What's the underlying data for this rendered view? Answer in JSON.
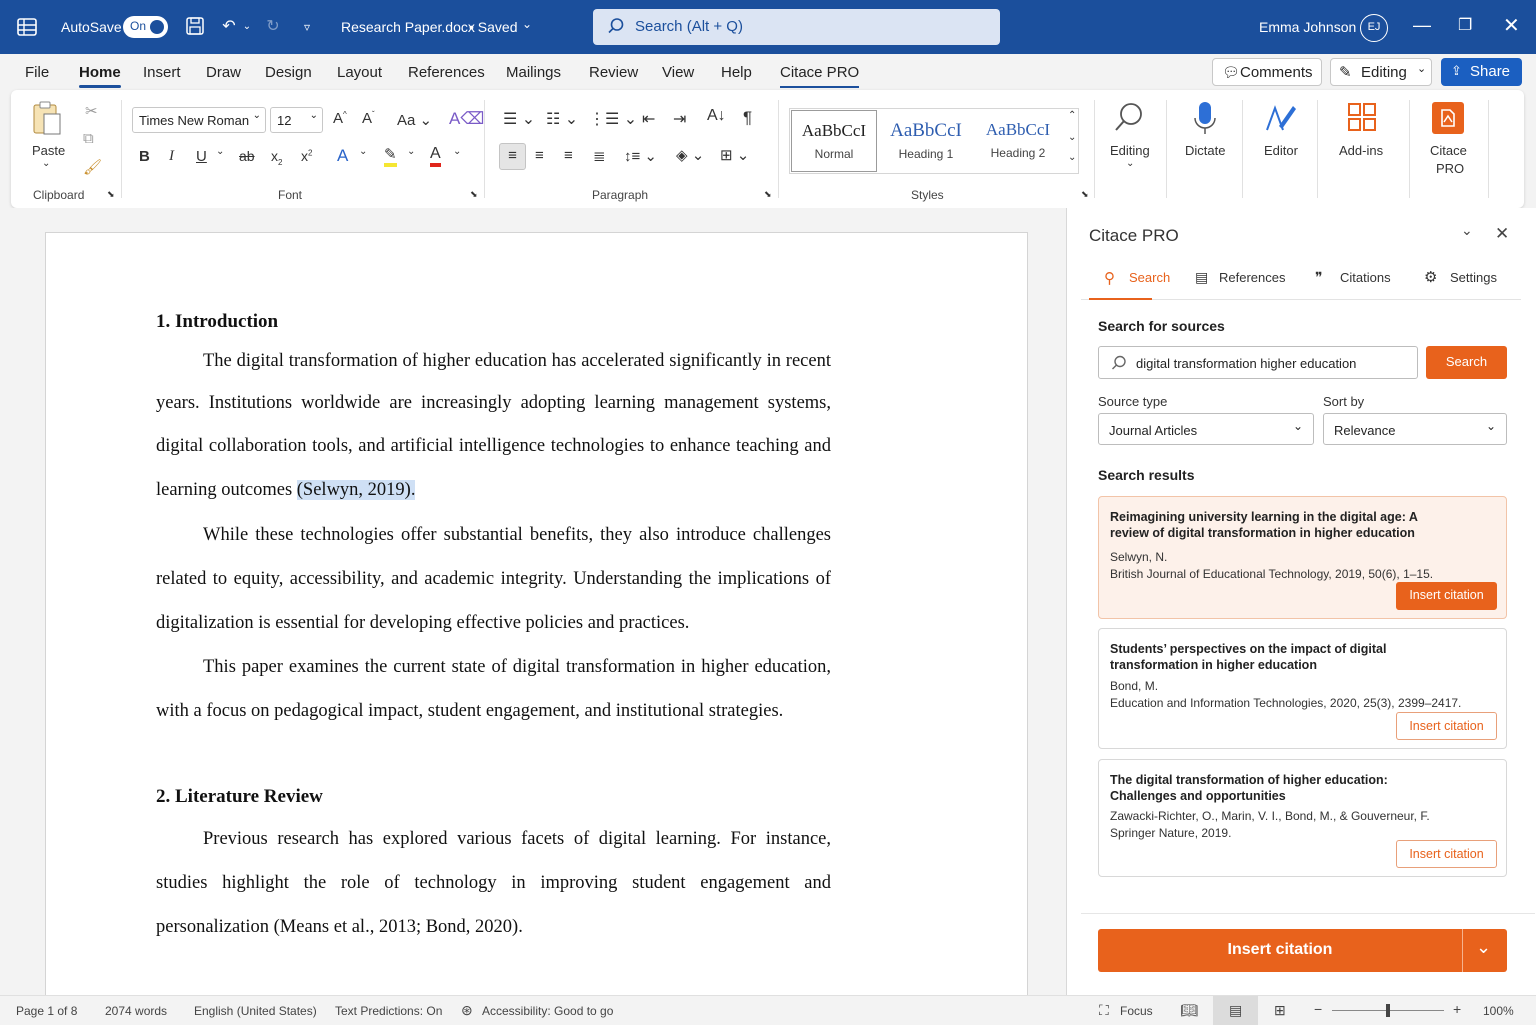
{
  "titlebar": {
    "autosave_label": "AutoSave",
    "autosave_state": "On",
    "doc_name": "Research Paper.docx",
    "doc_state": "• Saved",
    "search_placeholder": "Search (Alt + Q)",
    "user_name": "Emma Johnson",
    "user_initials": "EJ"
  },
  "menu": {
    "tabs": [
      "File",
      "Home",
      "Insert",
      "Draw",
      "Design",
      "Layout",
      "References",
      "Mailings",
      "Review",
      "View",
      "Help",
      "Citace PRO"
    ],
    "comments": "Comments",
    "editing": "Editing",
    "share": "Share"
  },
  "ribbon": {
    "clipboard": {
      "paste": "Paste",
      "label": "Clipboard"
    },
    "font": {
      "family": "Times New Roman",
      "size": "12",
      "label": "Font"
    },
    "paragraph": {
      "label": "Paragraph"
    },
    "styles": {
      "label": "Styles",
      "items": [
        {
          "sample": "AaBbCcI",
          "name": "Normal"
        },
        {
          "sample": "AaBbCcI",
          "name": "Heading 1"
        },
        {
          "sample": "AaBbCcI",
          "name": "Heading 2"
        }
      ]
    },
    "tools": {
      "editing": "Editing",
      "dictate": "Dictate",
      "editor": "Editor",
      "addins": "Add-ins",
      "citace_1": "Citace",
      "citace_2": "PRO"
    }
  },
  "document": {
    "h1": "1.  Introduction",
    "p1": [
      "The digital transformation of higher education has accelerated significantly in recent",
      "years. Institutions worldwide are increasingly adopting learning management systems,",
      "digital collaboration tools, and artificial intelligence technologies to enhance teaching and"
    ],
    "p1_last_pre": "learning outcomes ",
    "p1_last_hl": "(Selwyn, 2019).",
    "p2": [
      "While these technologies offer substantial benefits, they also introduce challenges",
      "related to equity, accessibility, and academic integrity. Understanding the implications of",
      "digitalization is essential for developing effective policies and practices."
    ],
    "p3": [
      "This paper examines the current state of digital transformation in higher education,",
      "with a focus on pedagogical impact, student engagement, and institutional strategies."
    ],
    "h2": "2.  Literature Review",
    "p4": [
      "Previous research has explored various facets of digital learning. For instance,",
      "studies highlight the role of technology in improving student engagement and",
      "personalization (Means et al., 2013; Bond, 2020)."
    ]
  },
  "pane": {
    "title": "Citace PRO",
    "tabs": [
      "Search",
      "References",
      "Citations",
      "Settings"
    ],
    "section_title": "Search for sources",
    "query": "digital transformation higher education",
    "search_button": "Search",
    "source_type_label": "Source type",
    "source_type_value": "Journal Articles",
    "sort_label": "Sort by",
    "sort_value": "Relevance",
    "results_title": "Search results",
    "results": [
      {
        "title": "Reimagining university learning in the digital age: A review of digital transformation in higher education",
        "authors": "Selwyn, N.",
        "source": "British Journal of Educational Technology, 2019, 50(6), 1–15.",
        "button": "Insert citation"
      },
      {
        "title": "Students’ perspectives on the impact of digital transformation in higher education",
        "authors": "Bond, M.",
        "source": "Education and Information Technologies, 2020, 25(3), 2399–2417.",
        "button": "Insert citation"
      },
      {
        "title": "The digital transformation of higher education: Challenges and opportunities",
        "authors": "Zawacki-Richter, O., Marin, V. I., Bond, M., & Gouverneur, F.",
        "source": "Springer Nature, 2019.",
        "button": "Insert citation"
      }
    ],
    "main_button": "Insert citation"
  },
  "status": {
    "page": "Page 1 of 8",
    "words": "2074 words",
    "language": "English (United States)",
    "predictions": "Text Predictions: On",
    "accessibility": "Accessibility: Good to go",
    "focus": "Focus",
    "zoom": "100%"
  },
  "colors": {
    "titlebar": "#1b4f9c",
    "accent": "#e8621c",
    "share": "#1b5fc1"
  }
}
